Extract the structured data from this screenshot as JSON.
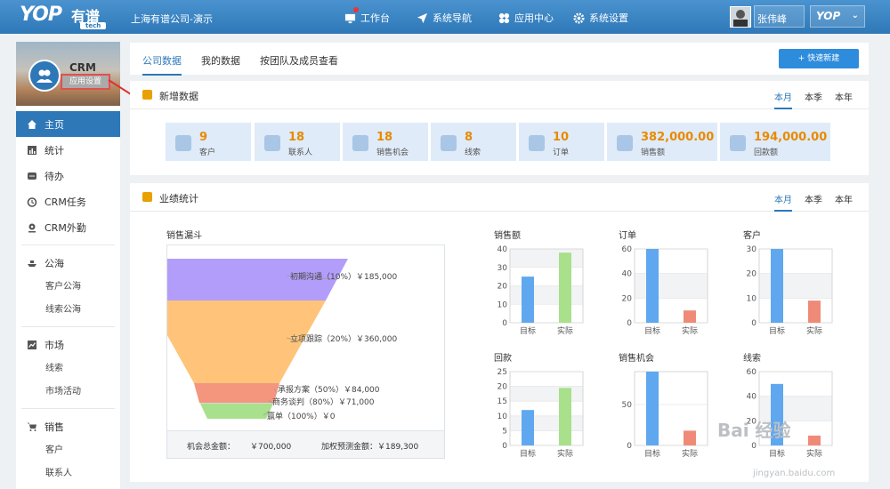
{
  "header": {
    "logo_text": "YOP",
    "logo_cn": "有谱",
    "logo_sub": "tech",
    "company": "上海有谱公司-演示",
    "nav": [
      {
        "label": "工作台",
        "icon": "monitor-icon"
      },
      {
        "label": "系统导航",
        "icon": "navigation-icon"
      },
      {
        "label": "应用中心",
        "icon": "apps-icon"
      },
      {
        "label": "系统设置",
        "icon": "gear-icon"
      }
    ],
    "user_name": "张伟峰",
    "org_switch": "YOP"
  },
  "sidebar": {
    "app_name": "CRM",
    "app_setting": "应用设置",
    "items": [
      {
        "label": "主页",
        "icon": "home-icon",
        "active": true
      },
      {
        "label": "统计",
        "icon": "stats-icon"
      },
      {
        "label": "待办",
        "icon": "todo-icon"
      },
      {
        "label": "CRM任务",
        "icon": "clock-icon"
      },
      {
        "label": "CRM外勤",
        "icon": "location-icon"
      }
    ],
    "groups": [
      {
        "label": "公海",
        "icon": "boat-icon",
        "children": [
          "客户公海",
          "线索公海"
        ]
      },
      {
        "label": "市场",
        "icon": "chart-icon",
        "children": [
          "线索",
          "市场活动"
        ]
      },
      {
        "label": "销售",
        "icon": "cart-icon",
        "children": [
          "客户",
          "联系人"
        ]
      }
    ]
  },
  "main": {
    "tabs": [
      "公司数据",
      "我的数据",
      "按团队及成员查看"
    ],
    "quick_new": "+ 快速新建"
  },
  "new_data": {
    "title": "新增数据",
    "periods": [
      "本月",
      "本季",
      "本年"
    ],
    "stats": [
      {
        "value": "9",
        "label": "客户",
        "icon": "customer-icon"
      },
      {
        "value": "18",
        "label": "联系人",
        "icon": "contact-icon"
      },
      {
        "value": "18",
        "label": "销售机会",
        "icon": "money-bag-icon"
      },
      {
        "value": "8",
        "label": "线索",
        "icon": "target-icon"
      },
      {
        "value": "10",
        "label": "订单",
        "icon": "order-icon"
      },
      {
        "value": "382,000.00",
        "label": "销售额",
        "icon": "pen-icon"
      },
      {
        "value": "194,000.00",
        "label": "回款额",
        "icon": "payment-icon"
      }
    ]
  },
  "performance": {
    "title": "业绩统计",
    "periods": [
      "本月",
      "本季",
      "本年"
    ],
    "funnel_title": "销售漏斗",
    "funnel_total_label": "机会总金额：",
    "funnel_total": "￥700,000",
    "funnel_weighted_label": "加权预测金额：",
    "funnel_weighted": "￥189,300"
  },
  "colors": {
    "brand": "#2e78b8",
    "target_bar": "#5fa8f0",
    "actual_bar_green": "#a8e08c",
    "actual_bar_red": "#f08a78",
    "value_orange": "#e88a00"
  },
  "watermark": {
    "text": "Bai 经验",
    "url": "jingyan.baidu.com"
  },
  "chart_data": [
    {
      "type": "funnel",
      "title": "销售漏斗",
      "stages": [
        {
          "label": "初期沟通（10%）￥185,000",
          "color": "#b39dfb"
        },
        {
          "label": "立项跟踪（20%）￥360,000",
          "color": "#ffc47a"
        },
        {
          "label": "承报方案（50%）￥84,000",
          "color": "#f4957e"
        },
        {
          "label": "商务谈判（80%）￥71,000",
          "color": "#d8d8d8"
        },
        {
          "label": "赢单（100%）￥0",
          "color": "#a8e08c"
        }
      ]
    },
    {
      "type": "bar",
      "title": "销售额",
      "categories": [
        "目标",
        "实际"
      ],
      "values": [
        25,
        38
      ],
      "ylim": [
        0,
        40
      ],
      "yticks": [
        0,
        10,
        20,
        30,
        40
      ]
    },
    {
      "type": "bar",
      "title": "订单",
      "categories": [
        "目标",
        "实际"
      ],
      "values": [
        60,
        10
      ],
      "ylim": [
        0,
        60
      ],
      "yticks": [
        0,
        20,
        40,
        60
      ]
    },
    {
      "type": "bar",
      "title": "客户",
      "categories": [
        "目标",
        "实际"
      ],
      "values": [
        30,
        9
      ],
      "ylim": [
        0,
        30
      ],
      "yticks": [
        0,
        10,
        20,
        30
      ]
    },
    {
      "type": "bar",
      "title": "回款",
      "categories": [
        "目标",
        "实际"
      ],
      "values": [
        12,
        19.5
      ],
      "ylim": [
        0,
        25
      ],
      "yticks": [
        0,
        5,
        10,
        15,
        20,
        25
      ]
    },
    {
      "type": "bar",
      "title": "销售机会",
      "categories": [
        "目标",
        "实际"
      ],
      "values": [
        90,
        18
      ],
      "ylim": [
        0,
        90
      ],
      "yticks": [
        0,
        50
      ]
    },
    {
      "type": "bar",
      "title": "线索",
      "categories": [
        "目标",
        "实际"
      ],
      "values": [
        50,
        8
      ],
      "ylim": [
        0,
        60
      ],
      "yticks": [
        0,
        20,
        40,
        60
      ]
    }
  ]
}
